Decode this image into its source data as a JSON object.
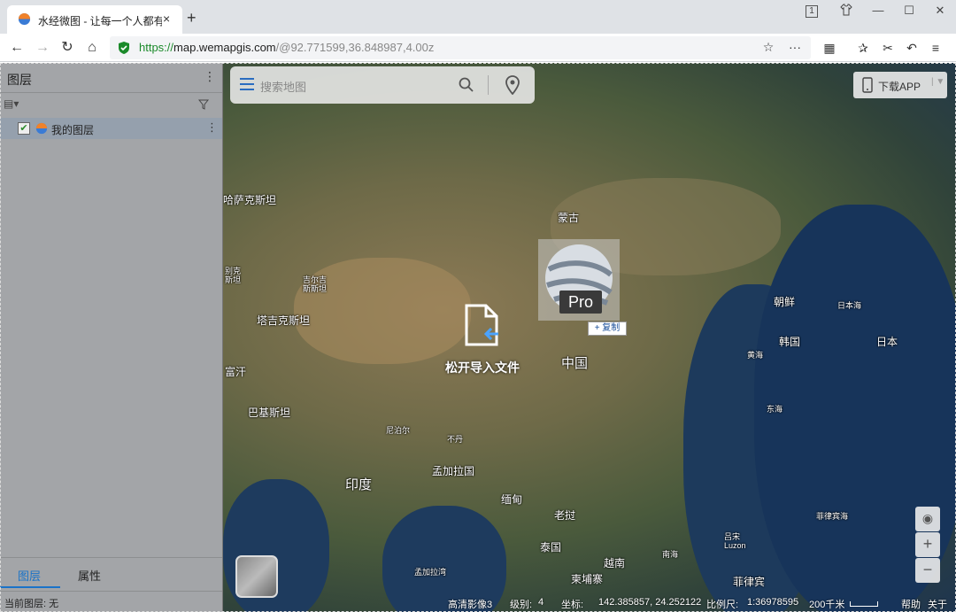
{
  "browser": {
    "tab_title": "水经微图 - 让每一个人都有自",
    "tab_close": "×",
    "new_tab": "+",
    "tab_count": "1",
    "url_scheme": "https://",
    "url_host": "map.wemapgis.com",
    "url_path": "/@92.771599,36.848987,4.00z"
  },
  "panel": {
    "title": "图层",
    "layer_name": "我的图层",
    "tabs": [
      "图层",
      "属性"
    ],
    "status": "当前图层: 无"
  },
  "map": {
    "search_placeholder": "搜索地图",
    "download_label": "下载APP",
    "drop_text": "松开导入文件",
    "pro_text": "Pro",
    "copy_text": "+ 复制",
    "zoom_in": "+",
    "zoom_out": "−",
    "labels": {
      "kazakhstan": "哈萨克斯坦",
      "mongolia": "蒙古",
      "turkmenistan": "塔吉克斯坦",
      "pakistan": "巴基斯坦",
      "china": "中国",
      "north_korea": "朝鲜",
      "south_korea": "韩国",
      "japan": "日本",
      "india": "印度",
      "bangladesh": "孟加拉国",
      "myanmar": "缅甸",
      "laos": "老挝",
      "thailand": "泰国",
      "vietnam": "越南",
      "cambodia": "柬埔寨",
      "philippines": "菲律宾",
      "nepal": "尼泊尔",
      "bhutan": "不丹",
      "rich": "富汗",
      "yellow_sea": "黄海",
      "east_sea": "东海",
      "japan_sea": "日本海",
      "south_sea": "南海",
      "phil_sea": "菲律宾海",
      "bay_bengal": "孟加拉湾",
      "luzon": "吕宋\nLuzon",
      "tajik": "别克\n斯坦",
      "kirgiz": "吉尔吉\n斯斯坦"
    },
    "status": {
      "imagery": "高清影像3",
      "level_label": "级别:",
      "level": "4",
      "coord_label": "坐标:",
      "coords": "142.385857, 24.252122",
      "scale_label": "比例尺:",
      "scale": "1:36978595",
      "scale_bar": "200千米",
      "help": "帮助",
      "about": "关于"
    }
  }
}
